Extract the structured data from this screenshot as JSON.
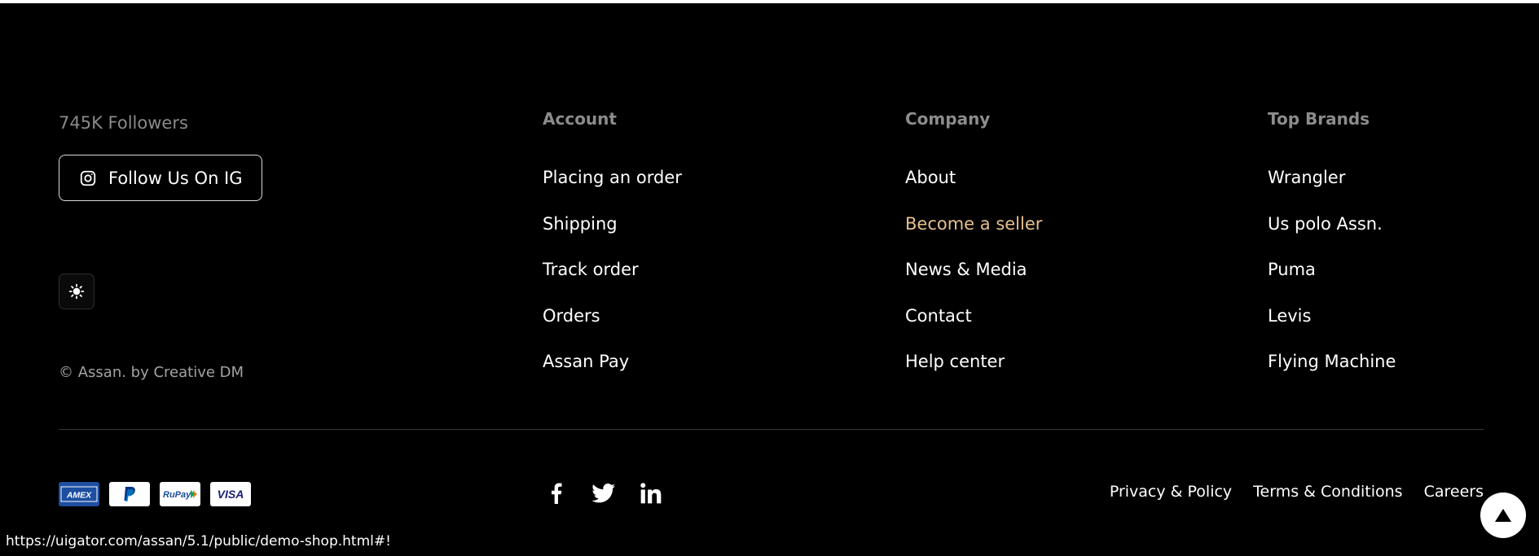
{
  "social": {
    "followers_text": "745K Followers",
    "follow_button_label": "Follow Us On IG",
    "icons": [
      "instagram-icon",
      "facebook-icon",
      "twitter-icon",
      "linkedin-icon"
    ]
  },
  "theme_toggle_icon": "sun-icon",
  "copyright": "© Assan. by Creative DM",
  "columns": {
    "account": {
      "heading": "Account",
      "items": [
        "Placing an order",
        "Shipping",
        "Track order",
        "Orders",
        "Assan Pay"
      ]
    },
    "company": {
      "heading": "Company",
      "items": [
        "About",
        "Become a seller",
        "News & Media",
        "Contact",
        "Help center"
      ]
    },
    "brands": {
      "heading": "Top Brands",
      "items": [
        "Wrangler",
        "Us polo Assn.",
        "Puma",
        "Levis",
        "Flying Machine"
      ]
    }
  },
  "payment_methods": [
    "AMEX",
    "PayPal",
    "RuPay",
    "VISA"
  ],
  "legal_links": [
    "Privacy & Policy",
    "Terms & Conditions",
    "Careers"
  ],
  "status_bar_url": "https://uigator.com/assan/5.1/public/demo-shop.html#!",
  "colors": {
    "background": "#000000",
    "accent": "#e7c08f",
    "heading": "#8c8c8c",
    "amex_blue": "#1d4ea1",
    "visa_blue": "#1a1f71",
    "paypal_blue": "#003087"
  }
}
